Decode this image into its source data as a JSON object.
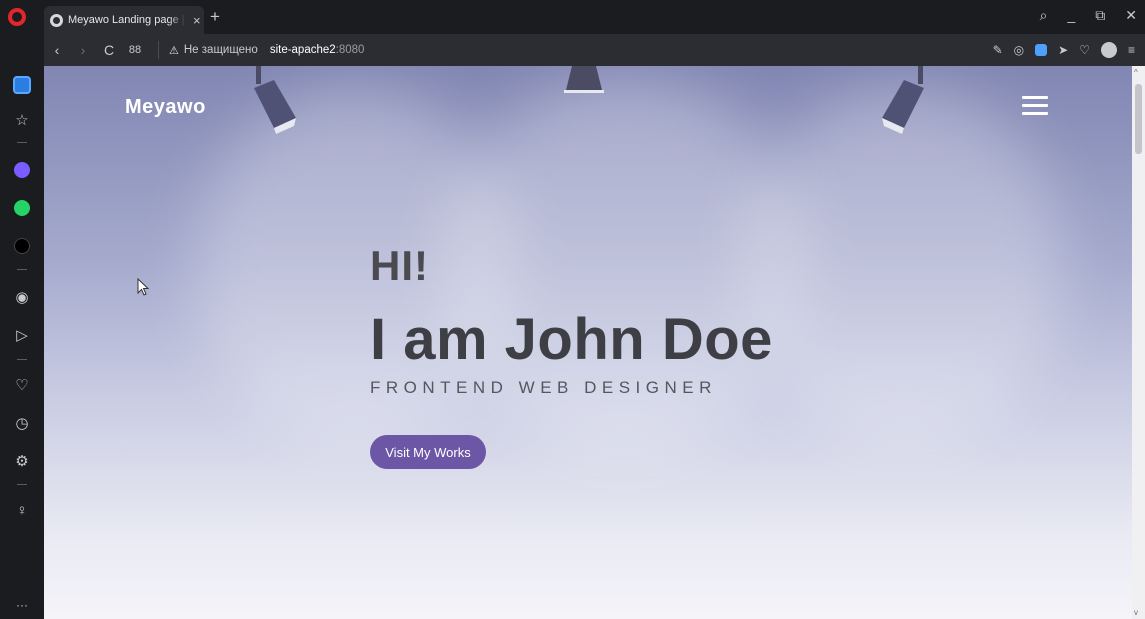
{
  "browser": {
    "tab_title": "Meyawo Landing page | Free",
    "tab_close": "×",
    "new_tab": "+",
    "window_controls": [
      "⌕",
      "_",
      "⧉",
      "✕"
    ],
    "nav": {
      "back": "‹",
      "forward": "›",
      "reload": "C",
      "tabs_overview": "88"
    },
    "security_icon": "⚠",
    "security_text": "Не защищено",
    "url_host": "site-apache2",
    "url_port": ":8080",
    "addr_icons": [
      "edit-icon",
      "camera-icon",
      "vpn-icon",
      "send-icon",
      "heart-icon",
      "profile-icon",
      "menu-icon"
    ],
    "addr_glyphs": [
      "✎",
      "◎",
      "➤",
      "♡",
      "≡"
    ],
    "accent": "#2a7de1"
  },
  "sidebar": {
    "glyphs": {
      "bookmarks": "☆",
      "player": "◉",
      "flow": "▷",
      "favorites": "♡",
      "history": "◷",
      "settings": "⚙",
      "tips": "♀",
      "more": "···"
    },
    "colors": {
      "messenger": "#7b5cff",
      "whatsapp": "#25d366",
      "tiktok": "#000000"
    }
  },
  "site": {
    "brand": "Meyawo",
    "hero_hi": "HI!",
    "hero_name": "I am John Doe",
    "hero_role": "FRONTEND WEB DESIGNER",
    "cta_label": "Visit My Works",
    "cta_color": "#6b57a6"
  },
  "scrollbar": {
    "up": "^",
    "down": "v"
  }
}
